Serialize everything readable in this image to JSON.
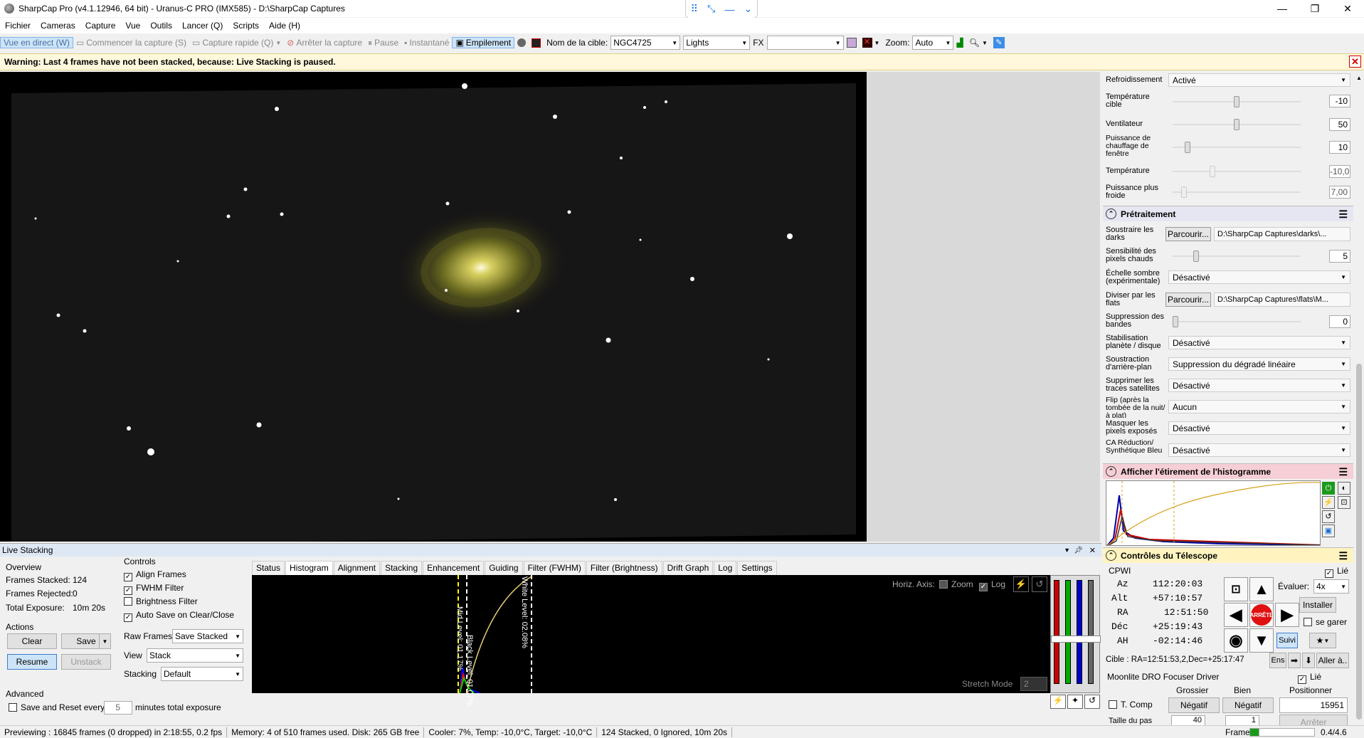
{
  "window": {
    "title": "SharpCap Pro (v4.1.12946, 64 bit) - Uranus-C PRO (IMX585) - D:\\SharpCap Captures",
    "minimize_icon": "minimize-icon",
    "maximize_icon": "restore-icon",
    "close_icon": "close-icon"
  },
  "menu": [
    "Fichier",
    "Cameras",
    "Capture",
    "Vue",
    "Outils",
    "Lancer (Q)",
    "Scripts",
    "Aide (H)"
  ],
  "toolbar": {
    "live_view": "Vue en direct (W)",
    "start_capture": "Commencer la capture (S)",
    "quick_capture": "Capture rapide (Q)",
    "stop_capture": "Arrêter la capture",
    "pause": "Pause",
    "snapshot": "Instantané",
    "stacking": "Empilement",
    "target_label": "Nom de la cible:",
    "target_value": "NGC4725",
    "frame_type": "Lights",
    "fx_label": "FX",
    "fx_value": "",
    "zoom_label": "Zoom:",
    "zoom_value": "Auto"
  },
  "warning": {
    "text": "Warning: Last 4 frames have not been stacked, because: Live Stacking is paused.",
    "close": "✕"
  },
  "right_panel": {
    "cooling_label": "Refroidissement",
    "cooling_value": "Activé",
    "target_temp_label": "Température cible",
    "target_temp_value": "-10",
    "target_temp_level": 0.5,
    "fan_label": "Ventilateur",
    "fan_value": "50",
    "fan_level": 0.5,
    "heater_label": "Puissance de chauffage de fenêtre",
    "heater_value": "10",
    "heater_level": 0.1,
    "temperature_label": "Température",
    "temperature_value": "-10,0",
    "temperature_level": 0.3,
    "cooler_power_label": "Puissance plus froide",
    "cooler_power_value": "7,00",
    "cooler_power_level": 0.07,
    "preprocessing_title": "Prétraitement",
    "darks_label": "Soustraire les darks",
    "darks_browse": "Parcourir...",
    "darks_path": "D:\\SharpCap Captures\\darks\\...",
    "hotpix_label": "Sensibilité des pixels chauds",
    "hotpix_value": "5",
    "hotpix_level": 0.17,
    "dark_scale_label": "Échelle sombre (expérimentale)",
    "dark_scale_value": "Désactivé",
    "flats_label": "Diviser par les flats",
    "flats_browse": "Parcourir...",
    "flats_path": "D:\\SharpCap Captures\\flats\\M...",
    "banding_label": "Suppression des bandes",
    "banding_value": "0",
    "banding_level": 0,
    "stab_label": "Stabilisation planète / disque",
    "stab_value": "Désactivé",
    "bg_label": "Soustraction d'arrière-plan",
    "bg_value": "Suppression du dégradé linéaire",
    "sat_label": "Supprimer les traces satellites",
    "sat_value": "Désactivé",
    "flip_label": "Flip (après la tombée de la nuit/à plat)",
    "flip_value": "Aucun",
    "mask_label": "Masquer les pixels exposés",
    "mask_value": "Désactivé",
    "ca_label": "CA Réduction/ Synthétique Bleu",
    "ca_value": "Désactivé",
    "hist_title": "Afficher l'étirement de l'histogramme",
    "telescope_title": "Contrôles du Télescope",
    "mount_name": "CPWI",
    "linked_label": "Lié",
    "az_label": "Az",
    "az_value": "112:20:03",
    "alt_label": "Alt",
    "alt_value": "+57:10:57",
    "ra_label": "RA",
    "ra_value": "12:51:50",
    "dec_label": "Déc",
    "dec_value": "+25:19:43",
    "ah_label": "AH",
    "ah_value": "-02:14:46",
    "rate_label": "Évaluer:",
    "rate_value": "4x",
    "stop_label": "ARRÊTE",
    "install_label": "Installer",
    "park_label": "se garer",
    "track_label": "Suivi",
    "target_coords": "Cible : RA=12:51:53,2,Dec=+25:17:47",
    "ens_label": "Ens",
    "goto_label": "Aller à..",
    "focuser_name": "Moonlite DRO Focuser Driver",
    "focuser_linked": "Lié",
    "coarse_label": "Grossier",
    "fine_label": "Bien",
    "position_label": "Positionner",
    "tcomp_label": "T. Comp",
    "neg_coarse": "Négatif",
    "neg_fine": "Négatif",
    "position_value": "15951",
    "step_label": "Taille du pas",
    "step_coarse": "40",
    "step_fine": "1",
    "stop_focus": "Arrêter"
  },
  "live_stacking": {
    "title": "Live Stacking",
    "overview_title": "Overview",
    "frames_stacked_label": "Frames Stacked:",
    "frames_stacked_value": "124",
    "frames_rejected_label": "Frames Rejected:",
    "frames_rejected_value": "0",
    "total_exposure_label": "Total Exposure:",
    "total_exposure_value": "10m 20s",
    "actions_title": "Actions",
    "clear": "Clear",
    "save": "Save",
    "resume": "Resume",
    "unstack": "Unstack",
    "advanced_title": "Advanced",
    "save_reset_label": "Save and Reset every",
    "save_reset_value": "5",
    "save_reset_suffix": "minutes total exposure",
    "controls_title": "Controls",
    "align_frames": "Align Frames",
    "fwhm_filter": "FWHM Filter",
    "brightness_filter": "Brightness Filter",
    "auto_save": "Auto Save on Clear/Close",
    "raw_frames_label": "Raw Frames",
    "raw_frames_value": "Save Stacked",
    "view_label": "View",
    "view_value": "Stack",
    "stacking_label": "Stacking",
    "stacking_value": "Default",
    "tabs": [
      "Status",
      "Histogram",
      "Alignment",
      "Stacking",
      "Enhancement",
      "Guiding",
      "Filter (FWHM)",
      "Filter (Brightness)",
      "Drift Graph",
      "Log",
      "Settings"
    ],
    "horiz_axis": "Horiz. Axis:",
    "zoom_label": "Zoom",
    "log_label": "Log",
    "stretch_mode_label": "Stretch Mode",
    "stretch_mode_value": "2",
    "mid_level": "Mid Level: 01.17%",
    "black_level": "Black Level: 01.07%",
    "white_level": "White Level: 02.08%"
  },
  "status_bar": {
    "preview": "Previewing : 16845 frames (0 dropped) in 2:18:55, 0.2 fps",
    "memory": "Memory: 4 of 510 frames used. Disk: 265 GB free",
    "cooler": "Cooler: 7%, Temp: -10,0°C, Target: -10,0°C",
    "stack": "124 Stacked, 0 Ignored, 10m 20s",
    "frame_label": "Frame :",
    "frame_value": "0.4/4.6",
    "frame_level": 0.087
  }
}
